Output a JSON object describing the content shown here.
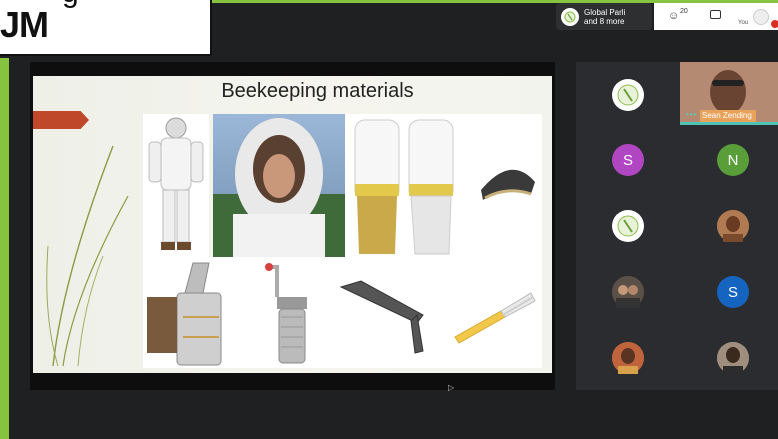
{
  "overlay": {
    "line1": "JM",
    "line2": "g"
  },
  "meeting": {
    "chip_line1": "Global Parli",
    "chip_line2": "and 8 more"
  },
  "topbar": {
    "people_count": "20",
    "you_label": "You"
  },
  "slide": {
    "title": "Beekeeping materials"
  },
  "participants": [
    {
      "initial": "",
      "color": "#ffffff",
      "icon": "globe-logo-icon"
    },
    {
      "initial": "S",
      "color": "#b146c2"
    },
    {
      "initial": "N",
      "color": "#5a9e3a"
    },
    {
      "initial": "",
      "color": "#ffffff",
      "icon": "globe-logo-icon"
    },
    {
      "initial": "S",
      "color": "#1565c0"
    }
  ],
  "video": {
    "name": "Sean Zending"
  },
  "colors": {
    "accent_green": "#86c440",
    "dark_bg": "#1f2022",
    "panel": "#2b2c2f"
  }
}
